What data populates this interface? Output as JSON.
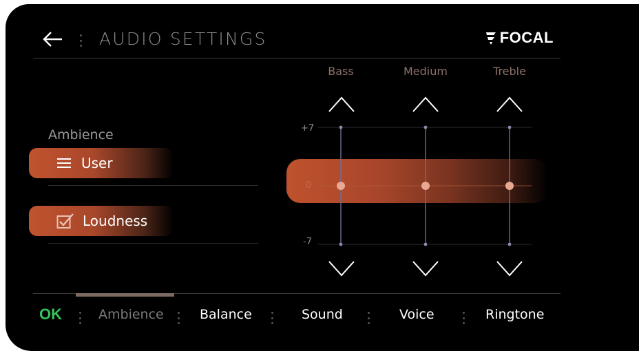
{
  "header": {
    "title": "AUDIO SETTINGS",
    "brand": "FOCAL"
  },
  "ambience": {
    "label": "Ambience",
    "preset_label": "User",
    "loudness_label": "Loudness",
    "loudness_checked": true
  },
  "equalizer": {
    "bands": [
      {
        "label": "Bass",
        "value": 0
      },
      {
        "label": "Medium",
        "value": 0
      },
      {
        "label": "Treble",
        "value": 0
      }
    ],
    "max_label": "+7",
    "zero_label": "0",
    "min_label": "-7"
  },
  "footer": {
    "ok_label": "OK",
    "tabs": [
      {
        "label": "Ambience",
        "active": true
      },
      {
        "label": "Balance",
        "active": false
      },
      {
        "label": "Sound",
        "active": false
      },
      {
        "label": "Voice",
        "active": false
      },
      {
        "label": "Ringtone",
        "active": false
      }
    ]
  },
  "colors": {
    "accent": "#c1532f",
    "ok_green": "#37c45a",
    "background": "#000000"
  }
}
